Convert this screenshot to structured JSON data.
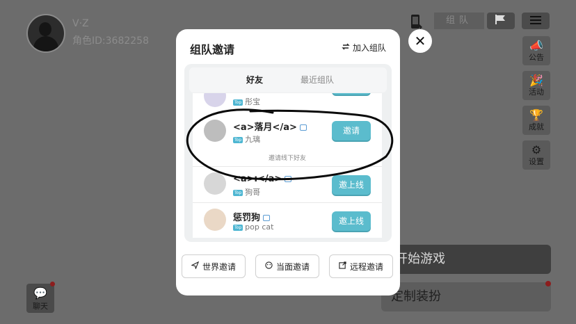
{
  "profile": {
    "name": "V·Z",
    "role_id": "角色ID:3682258"
  },
  "toolbar": {
    "team_tab": "组队"
  },
  "side_buttons": [
    {
      "label": "公告",
      "icon": "megaphone-icon"
    },
    {
      "label": "活动",
      "icon": "party-icon"
    },
    {
      "label": "成就",
      "icon": "trophy-icon"
    },
    {
      "label": "设置",
      "icon": "gear-icon"
    }
  ],
  "main": {
    "start_label": "开始游戏",
    "custom_label": "定制装扮",
    "chat_label": "聊天"
  },
  "modal": {
    "title": "组队邀请",
    "join_label": "加入组队",
    "tabs": {
      "friends": "好友",
      "recent": "最近组队"
    },
    "rows": [
      {
        "name": "",
        "sub": "彤宝",
        "tag": "Top",
        "action": ""
      },
      {
        "name": "<a>落月</a>",
        "sub": "九璃",
        "tag": "Top",
        "action": "邀请"
      },
      {
        "name": "<a>ı</a>",
        "sub": "狗哥",
        "tag": "Top",
        "action": "邀上线"
      },
      {
        "name": "惩罚狗",
        "sub": "pop cat",
        "tag": "Top",
        "action": "邀上线"
      }
    ],
    "offline_hint": "邀请线下好友",
    "bottom": {
      "world": "世界邀请",
      "face": "当面邀请",
      "remote": "远程邀请"
    }
  },
  "colors": {
    "accent": "#5bbccd",
    "alert": "#8c1d1d"
  }
}
